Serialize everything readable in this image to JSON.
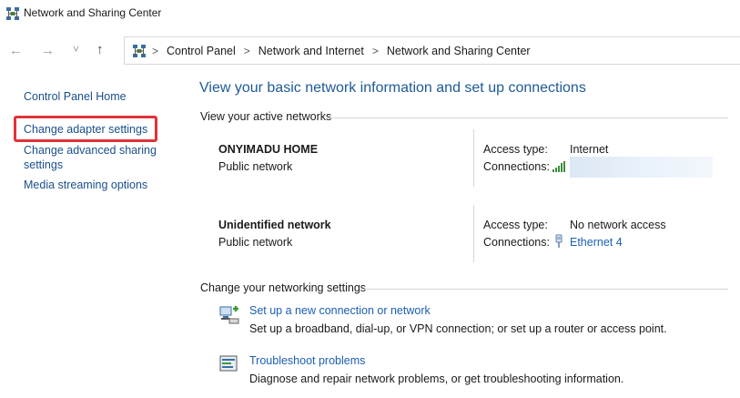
{
  "window": {
    "title": "Network and Sharing Center"
  },
  "nav": {
    "back": "←",
    "forward": "→",
    "recent": "˅",
    "up": "↑"
  },
  "breadcrumb": {
    "items": [
      "Control Panel",
      "Network and Internet",
      "Network and Sharing Center"
    ],
    "separator": ">"
  },
  "sidebar": {
    "items": [
      {
        "label": "Control Panel Home"
      },
      {
        "label": "Change adapter settings",
        "highlighted": true
      },
      {
        "label_line1": "Change advanced sharing",
        "label_line2": "settings"
      },
      {
        "label": "Media streaming options"
      }
    ]
  },
  "main": {
    "heading": "View your basic network information and set up connections",
    "active_networks_label": "View your active networks",
    "networks": [
      {
        "name": "ONYIMADU HOME",
        "type": "Public network",
        "access_type_label": "Access type:",
        "access_type": "Internet",
        "connections_label": "Connections:",
        "connection_icon": "wifi-signal-icon",
        "connection_value_hidden": true
      },
      {
        "name": "Unidentified network",
        "type": "Public network",
        "access_type_label": "Access type:",
        "access_type": "No network access",
        "connections_label": "Connections:",
        "connection_icon": "ethernet-plug-icon",
        "connection": "Ethernet 4"
      }
    ],
    "change_settings_label": "Change your networking settings",
    "tasks": [
      {
        "icon": "new-connection-icon",
        "title": "Set up a new connection or network",
        "description": "Set up a broadband, dial-up, or VPN connection; or set up a router or access point."
      },
      {
        "icon": "troubleshoot-icon",
        "title": "Troubleshoot problems",
        "description": "Diagnose and repair network problems, or get troubleshooting information."
      }
    ]
  },
  "colors": {
    "link": "#1a5fb4",
    "heading": "#1e5a96",
    "highlight": "#e0323a"
  }
}
